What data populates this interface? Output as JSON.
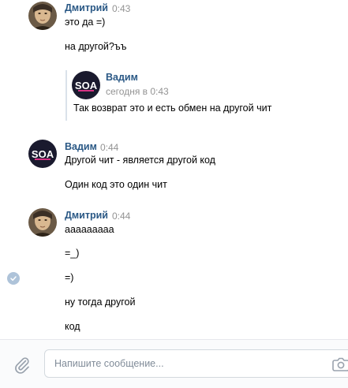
{
  "messages": [
    {
      "author": "Дмитрий",
      "time": "0:43",
      "lines": [
        "это да =)",
        "на другой?ъъ"
      ]
    },
    {
      "forwarded": {
        "author": "Вадим",
        "date": "сегодня в 0:43",
        "text": "Так возврат это и есть обмен на другой чит"
      }
    },
    {
      "author": "Вадим",
      "time": "0:44",
      "lines": [
        "Другой чит - является другой код",
        "Один код это один чит"
      ]
    },
    {
      "author": "Дмитрий",
      "time": "0:44",
      "lines": [
        "ааааааааа",
        "=_)",
        "=)",
        "ну тогда другой",
        "код"
      ]
    }
  ],
  "avatar_logo_text": "SOA",
  "composer": {
    "placeholder": "Напишите сообщение..."
  },
  "colors": {
    "name": "#2a5885",
    "time": "#939393",
    "check": "#aec3d9",
    "logo_bg": "#1a1a2e",
    "logo_text": "#d63384"
  }
}
